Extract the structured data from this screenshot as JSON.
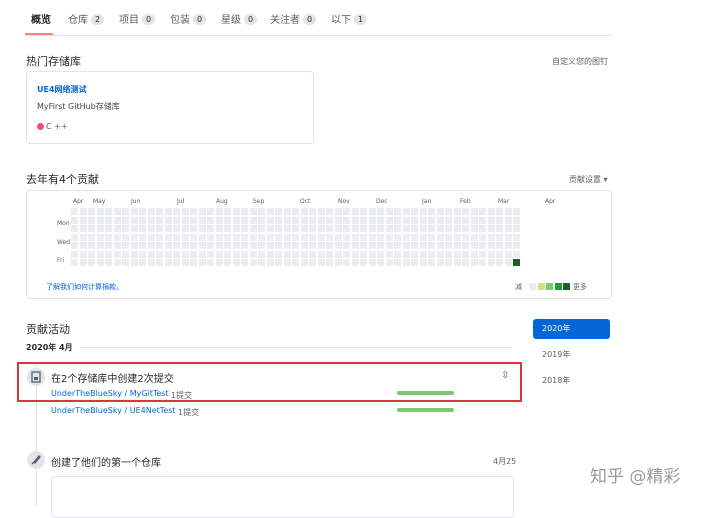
{
  "tabs": [
    {
      "label": "概览",
      "count": ""
    },
    {
      "label": "仓库",
      "count": "2"
    },
    {
      "label": "项目",
      "count": "0"
    },
    {
      "label": "包装",
      "count": "0"
    },
    {
      "label": "星级",
      "count": "0"
    },
    {
      "label": "关注者",
      "count": "0"
    },
    {
      "label": "以下",
      "count": "1"
    }
  ],
  "popular": {
    "title": "热门存储库",
    "customize": "自定义您的图钉"
  },
  "repo": {
    "name": "UE4网络测试",
    "desc": "MyFirst GitHub存储库",
    "lang": "C ++",
    "lang_color": "#f34b7d"
  },
  "contrib": {
    "title": "去年有4个贡献",
    "settings": "贡献设置 ▾",
    "months": [
      "Apr",
      "May",
      "Jun",
      "Jul",
      "Aug",
      "Sep",
      "Oct",
      "Nov",
      "Dec",
      "Jan",
      "Feb",
      "Mar",
      "Apr"
    ],
    "days": [
      "Mon",
      "Wed",
      "Fri"
    ],
    "learn": "了解我们如何计算捐款。",
    "less": "减",
    "more": "更多",
    "legend_colors": [
      "#ebedf0",
      "#c6e48b",
      "#7bc96f",
      "#239a3b",
      "#196127"
    ]
  },
  "activity": {
    "title": "贡献活动",
    "month": "2020年 4月",
    "years": [
      "2020年",
      "2019年",
      "2018年"
    ],
    "event1": "在2个存储库中创建2次提交",
    "repos": [
      {
        "name": "UnderTheBlueSky / MyGitTest",
        "commits": "1提交"
      },
      {
        "name": "UnderTheBlueSky / UE4NetTest",
        "commits": "1提交"
      }
    ],
    "event2": "创建了他们的第一个仓库",
    "event2_date": "4月25"
  },
  "watermark": "知乎 @精彩"
}
